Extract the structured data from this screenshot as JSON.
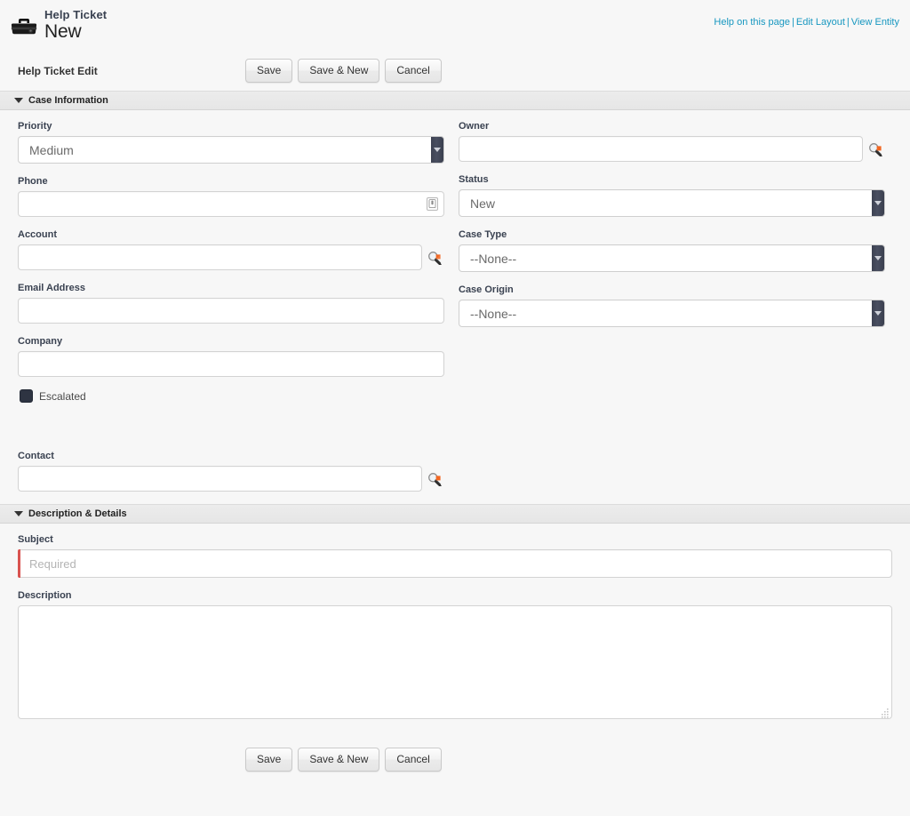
{
  "header": {
    "entity_icon": "toolbox-icon",
    "entity_name": "Help Ticket",
    "record_title": "New",
    "links": [
      {
        "label": "Help on this page",
        "name": "help-on-this-page-link"
      },
      {
        "label": "Edit Layout",
        "name": "edit-layout-link"
      },
      {
        "label": "View Entity",
        "name": "view-entity-link"
      }
    ],
    "link_separator": "|",
    "link_color": "#1797c0"
  },
  "edit_bar": {
    "title": "Help Ticket Edit",
    "buttons": {
      "save": "Save",
      "save_and_new": "Save & New",
      "cancel": "Cancel"
    }
  },
  "sections": {
    "case_information": {
      "title": "Case Information",
      "expanded": true
    },
    "description_details": {
      "title": "Description & Details",
      "expanded": true
    }
  },
  "fields": {
    "priority": {
      "label": "Priority",
      "type": "select",
      "value": "Medium",
      "icon": "chevron-down-icon"
    },
    "owner": {
      "label": "Owner",
      "type": "lookup",
      "value": "",
      "placeholder": "",
      "icon": "lookup-search-icon"
    },
    "phone": {
      "label": "Phone",
      "type": "text",
      "value": "",
      "placeholder": "",
      "icon": "phone-card-icon"
    },
    "status": {
      "label": "Status",
      "type": "select",
      "value": "New",
      "icon": "chevron-down-icon"
    },
    "account": {
      "label": "Account",
      "type": "lookup",
      "value": "",
      "placeholder": "",
      "icon": "lookup-search-icon"
    },
    "case_type": {
      "label": "Case Type",
      "type": "select",
      "value": "--None--",
      "icon": "chevron-down-icon"
    },
    "email_address": {
      "label": "Email Address",
      "type": "text",
      "value": "",
      "placeholder": ""
    },
    "case_origin": {
      "label": "Case Origin",
      "type": "select",
      "value": "--None--",
      "icon": "chevron-down-icon"
    },
    "company": {
      "label": "Company",
      "type": "text",
      "value": "",
      "placeholder": ""
    },
    "escalated": {
      "label": "Escalated",
      "type": "checkbox",
      "checked": false
    },
    "contact": {
      "label": "Contact",
      "type": "lookup",
      "value": "",
      "placeholder": "",
      "icon": "lookup-search-icon"
    },
    "subject": {
      "label": "Subject",
      "type": "text",
      "value": "",
      "placeholder": "Required",
      "required": true,
      "required_color": "#d9534f"
    },
    "description": {
      "label": "Description",
      "type": "textarea",
      "value": "",
      "placeholder": ""
    }
  },
  "footer": {
    "buttons": {
      "save": "Save",
      "save_and_new": "Save & New",
      "cancel": "Cancel"
    }
  }
}
